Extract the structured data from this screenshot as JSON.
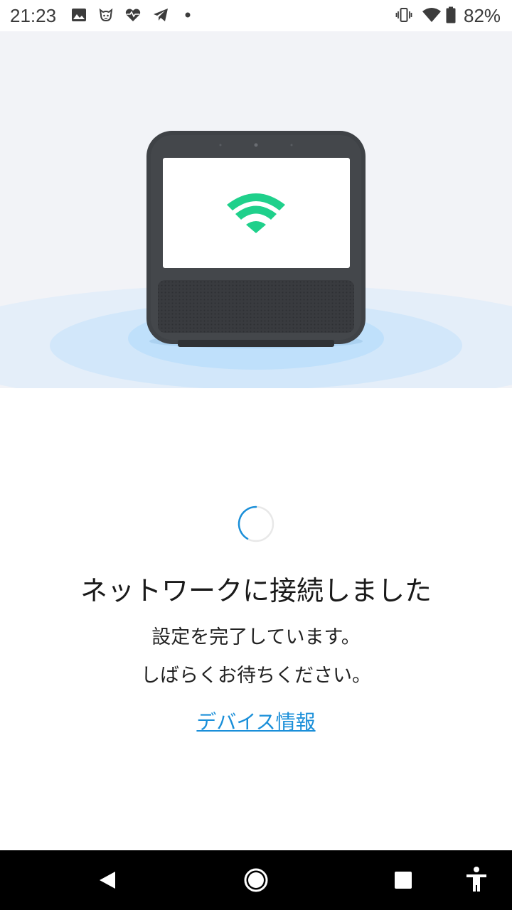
{
  "status_bar": {
    "time": "21:23",
    "battery": "82%",
    "notification_icons": [
      "image-icon",
      "cat-face-icon",
      "heart-pulse-icon",
      "telegram-icon",
      "dot-icon"
    ],
    "system_icons": [
      "vibrate-icon",
      "wifi-icon",
      "battery-icon"
    ]
  },
  "hero": {
    "device": "smart-display-illustration",
    "screen_icon": "wifi-icon",
    "wifi_color": "#1fd08b",
    "ripple_color": "#bfe0fb"
  },
  "main": {
    "title": "ネットワークに接続しました",
    "message_line1": "設定を完了しています。",
    "message_line2": "しばらくお待ちください。",
    "link_label": "デバイス情報",
    "accent_color": "#1a8fd9"
  },
  "nav_bar": {
    "buttons": [
      "back-icon",
      "home-icon",
      "recents-icon",
      "accessibility-icon"
    ]
  }
}
